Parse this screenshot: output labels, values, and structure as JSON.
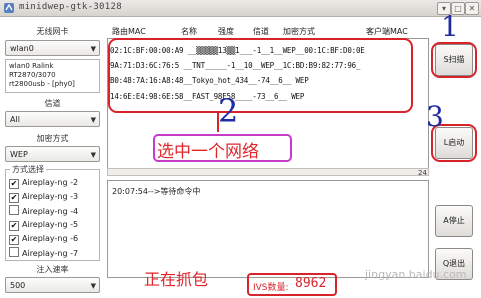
{
  "window": {
    "title": "minidwep-gtk-30128",
    "buttons": [
      "▾",
      "□",
      "✕"
    ]
  },
  "left_panel": {
    "wireless_label": "无线网卡",
    "adapter_value": "wlan0",
    "adapter_info": [
      "wlan0 Ralink",
      "RT2870/3070",
      "rt2800usb - [phy0]"
    ],
    "channel_label": "信道",
    "channel_value": "All",
    "encryption_label": "加密方式",
    "encryption_value": "WEP",
    "method_label": "方式选择",
    "methods": [
      {
        "label": "Aireplay-ng -2",
        "checked": true
      },
      {
        "label": "Aireplay-ng -3",
        "checked": true
      },
      {
        "label": "Aireplay-ng -4",
        "checked": false
      },
      {
        "label": "Aireplay-ng -5",
        "checked": true
      },
      {
        "label": "Aireplay-ng -6",
        "checked": true
      },
      {
        "label": "Aireplay-ng -7",
        "checked": false
      }
    ],
    "rate_label": "注入速率",
    "rate_value": "500"
  },
  "table": {
    "headers": [
      "路由MAC",
      "名称",
      "强度",
      "信道",
      "加密方式",
      "客户端MAC"
    ],
    "rows": [
      "02:1C:BF:00:00:A9 __▒▒▒▒▒13▒▒1___-1__1__WEP__00:1C:BF:D0:0E",
      "9A:71:D3:6C:76:5 __TNT_____-1__10__WEP__1C:BD:B9:82:77:96_",
      "B0:48:7A:16:A8:48__Tokyo_hot_434__-74__6__ WEP",
      "14:6E:E4:98:6E:58__FAST_98E58____-73__6__ WEP"
    ],
    "counter": "24"
  },
  "log": {
    "lines": [
      "20:07:54-->等待命令中"
    ]
  },
  "buttons": {
    "scan": "S扫描",
    "launch": "L启动",
    "stop": "A停止",
    "exit": "Q退出"
  },
  "annotations": {
    "num1": "1",
    "num2": "2",
    "num3": "3",
    "select_network": "选中一个网络",
    "capturing": "正在抓包",
    "ivs_label": "IVS数量:",
    "ivs_value": "8962",
    "watermark": "jingyan.baidu.com"
  },
  "colors": {
    "annotation_red": "#d8232a",
    "annotation_blue": "#1f2ba0",
    "annotation_purple": "#c43cc8"
  }
}
